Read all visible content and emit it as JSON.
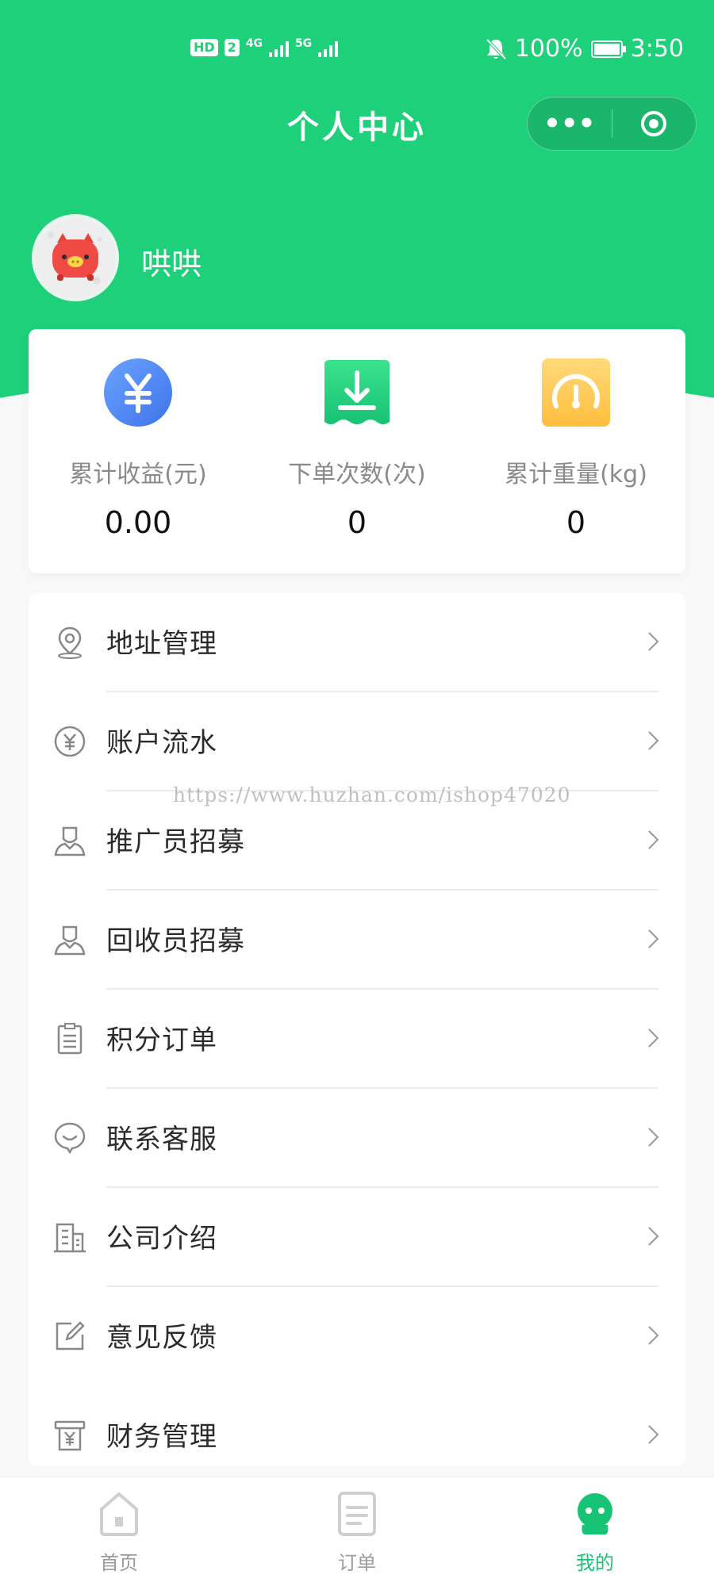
{
  "status_bar": {
    "hd": "HD",
    "sim": "2",
    "net1": "4G",
    "net2": "5G",
    "battery": "100%",
    "time": "3:50"
  },
  "header": {
    "title": "个人中心",
    "more_label": "•••"
  },
  "profile": {
    "username": "哄哄"
  },
  "stats": [
    {
      "label": "累计收益(元)",
      "value": "0.00",
      "icon": "yuan-icon",
      "color": "#4f86f7"
    },
    {
      "label": "下单次数(次)",
      "value": "0",
      "icon": "download-icon",
      "color": "#22d07a"
    },
    {
      "label": "累计重量(kg)",
      "value": "0",
      "icon": "gauge-icon",
      "color": "#ffc95b"
    }
  ],
  "menu": [
    {
      "label": "地址管理",
      "icon": "location-icon"
    },
    {
      "label": "账户流水",
      "icon": "yuan-circle-icon"
    },
    {
      "label": "推广员招募",
      "icon": "person-icon"
    },
    {
      "label": "回收员招募",
      "icon": "person-icon"
    },
    {
      "label": "积分订单",
      "icon": "clipboard-icon"
    },
    {
      "label": "联系客服",
      "icon": "chat-icon"
    },
    {
      "label": "公司介绍",
      "icon": "building-icon"
    },
    {
      "label": "意见反馈",
      "icon": "edit-icon"
    },
    {
      "label": "财务管理",
      "icon": "finance-icon"
    }
  ],
  "watermark": "https://www.huzhan.com/ishop47020",
  "tabs": [
    {
      "label": "首页",
      "icon": "home-icon",
      "active": false
    },
    {
      "label": "订单",
      "icon": "order-icon",
      "active": false
    },
    {
      "label": "我的",
      "icon": "profile-icon",
      "active": true
    }
  ],
  "colors": {
    "brand_green": "#1ed07a",
    "active_tab": "#17c475"
  }
}
